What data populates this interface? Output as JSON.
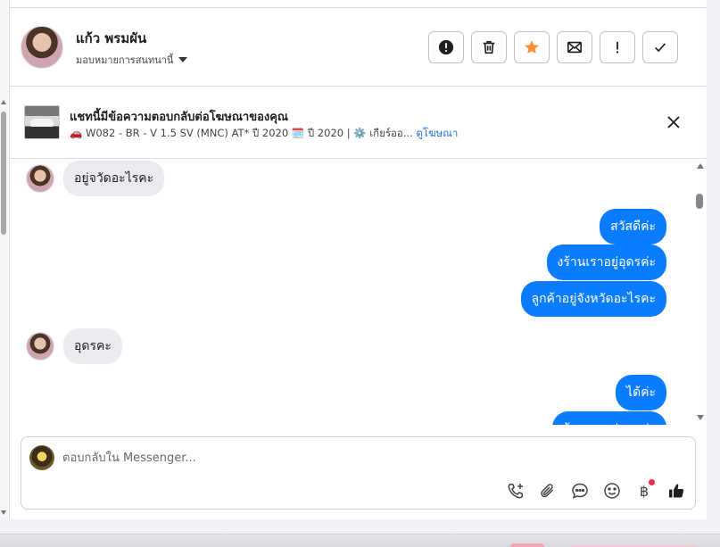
{
  "header": {
    "contact_name": "แก้ว พรมผัน",
    "assign_label": "มอบหมายการสนทนานี้",
    "actions": [
      {
        "name": "report-button",
        "icon": "alert-circle-icon"
      },
      {
        "name": "delete-button",
        "icon": "trash-icon"
      },
      {
        "name": "star-button",
        "icon": "star-icon"
      },
      {
        "name": "mark-unread-button",
        "icon": "envelope-icon"
      },
      {
        "name": "follow-up-button",
        "icon": "exclamation-icon"
      },
      {
        "name": "mark-done-button",
        "icon": "checkmark-icon"
      }
    ]
  },
  "ad": {
    "title": "แชทนี้มีข้อความตอบกลับต่อโฆษณาของคุณ",
    "details": "🚗 W082 - BR - V 1.5 SV (MNC) AT* ปี 2020 🗓️ ปี 2020 | ⚙️ เกียร์ออ...",
    "link": "ดูโฆษณา"
  },
  "messages": [
    {
      "dir": "in",
      "text": "อยู่จวัดอะไรคะ"
    },
    {
      "dir": "out",
      "text": "สวัสดีค่ะ"
    },
    {
      "dir": "out",
      "text": "งร้านเราอยู่อุดรค่ะ"
    },
    {
      "dir": "out",
      "text": "ลูกค้าอยู่จังหวัดอะไรคะ"
    },
    {
      "dir": "in",
      "text": "อุดรคะ"
    },
    {
      "dir": "out",
      "text": "ได้ค่ะ"
    },
    {
      "dir": "out",
      "text": "ร้านเราอยู่อุดรค่ะ"
    }
  ],
  "composer": {
    "placeholder": "ตอบกลับใน Messenger...",
    "baht_symbol": "฿"
  },
  "colors": {
    "outgoing_bubble": "#0a7cff",
    "incoming_bubble": "#e9ebee",
    "link": "#216fdb",
    "star": "#f7923a",
    "notification": "#f02849"
  }
}
